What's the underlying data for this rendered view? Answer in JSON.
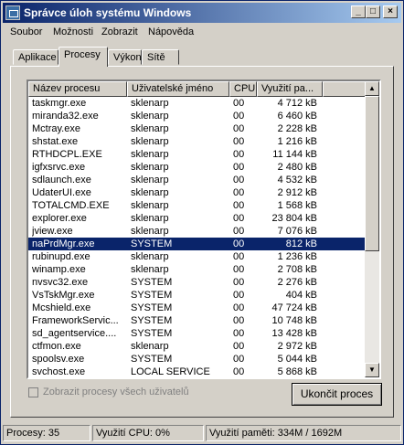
{
  "window": {
    "title": "Správce úloh systému Windows"
  },
  "menu": [
    "Soubor",
    "Možnosti",
    "Zobrazit",
    "Nápověda"
  ],
  "tabs": [
    {
      "label": "Aplikace",
      "active": false
    },
    {
      "label": "Procesy",
      "active": true
    },
    {
      "label": "Výkon",
      "active": false
    },
    {
      "label": "Sítě",
      "active": false
    }
  ],
  "columns": [
    "Název procesu",
    "Uživatelské jméno",
    "CPU",
    "Využití pa..."
  ],
  "processes": [
    [
      "taskmgr.exe",
      "sklenarp",
      "00",
      "4 712 kB"
    ],
    [
      "miranda32.exe",
      "sklenarp",
      "00",
      "6 460 kB"
    ],
    [
      "Mctray.exe",
      "sklenarp",
      "00",
      "2 228 kB"
    ],
    [
      "shstat.exe",
      "sklenarp",
      "00",
      "1 216 kB"
    ],
    [
      "RTHDCPL.EXE",
      "sklenarp",
      "00",
      "11 144 kB"
    ],
    [
      "igfxsrvc.exe",
      "sklenarp",
      "00",
      "2 480 kB"
    ],
    [
      "sdlaunch.exe",
      "sklenarp",
      "00",
      "4 532 kB"
    ],
    [
      "UdaterUI.exe",
      "sklenarp",
      "00",
      "2 912 kB"
    ],
    [
      "TOTALCMD.EXE",
      "sklenarp",
      "00",
      "1 568 kB"
    ],
    [
      "explorer.exe",
      "sklenarp",
      "00",
      "23 804 kB"
    ],
    [
      "jview.exe",
      "sklenarp",
      "00",
      "7 076 kB"
    ],
    [
      "naPrdMgr.exe",
      "SYSTEM",
      "00",
      "812 kB"
    ],
    [
      "rubinupd.exe",
      "sklenarp",
      "00",
      "1 236 kB"
    ],
    [
      "winamp.exe",
      "sklenarp",
      "00",
      "2 708 kB"
    ],
    [
      "nvsvc32.exe",
      "SYSTEM",
      "00",
      "2 276 kB"
    ],
    [
      "VsTskMgr.exe",
      "SYSTEM",
      "00",
      "404 kB"
    ],
    [
      "Mcshield.exe",
      "SYSTEM",
      "00",
      "47 724 kB"
    ],
    [
      "FrameworkServic...",
      "SYSTEM",
      "00",
      "10 748 kB"
    ],
    [
      "sd_agentservice....",
      "SYSTEM",
      "00",
      "13 428 kB"
    ],
    [
      "ctfmon.exe",
      "sklenarp",
      "00",
      "2 972 kB"
    ],
    [
      "spoolsv.exe",
      "SYSTEM",
      "00",
      "5 044 kB"
    ],
    [
      "svchost.exe",
      "LOCAL SERVICE",
      "00",
      "5 868 kB"
    ]
  ],
  "selected_process": "naPrdMgr.exe",
  "show_all_users_label": "Zobrazit procesy všech uživatelů",
  "show_all_users_checked": false,
  "end_process_label": "Ukončit proces",
  "status": {
    "processes": "Procesy: 35",
    "cpu": "Využití CPU: 0%",
    "memory": "Využití paměti: 334M / 1692M"
  },
  "colors": {
    "title_start": "#0a246a",
    "title_end": "#a6caf0",
    "selection": "#0a246a",
    "face": "#d4d0c8"
  }
}
